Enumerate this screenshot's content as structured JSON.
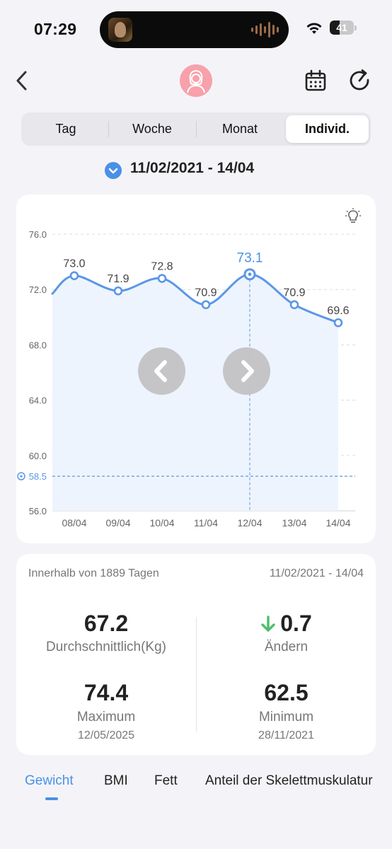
{
  "status": {
    "time": "07:29",
    "battery": "41",
    "battery_level": 0.41
  },
  "header": {
    "avatar_icon": "avatar-icon",
    "calendar_icon": "calendar-icon",
    "refresh_icon": "refresh-icon",
    "back_icon": "back-chevron-icon"
  },
  "segments": [
    {
      "label": "Tag",
      "active": false
    },
    {
      "label": "Woche",
      "active": false
    },
    {
      "label": "Monat",
      "active": false
    },
    {
      "label": "Individ.",
      "active": true
    }
  ],
  "date_range": "11/02/2021 - 14/04",
  "chart_data": {
    "type": "line",
    "categories": [
      "08/04",
      "09/04",
      "10/04",
      "11/04",
      "12/04",
      "13/04",
      "14/04"
    ],
    "values": [
      73.0,
      71.9,
      72.8,
      70.9,
      73.1,
      70.9,
      69.6
    ],
    "value_labels": [
      "73.0",
      "71.9",
      "72.8",
      "70.9",
      "73.1",
      "70.9",
      "69.6"
    ],
    "selected_index": 4,
    "y_ticks": [
      "76.0",
      "72.0",
      "68.0",
      "64.0",
      "60.0",
      "56.0"
    ],
    "ylim": [
      56,
      76
    ],
    "target_label": "58.5",
    "target_value": 58.5,
    "line_color": "#5b97e6",
    "grid": true
  },
  "stats": {
    "period": "Innerhalb von 1889 Tagen",
    "range": "11/02/2021 - 14/04",
    "average": {
      "value": "67.2",
      "label": "Durchschnittlich(Kg)"
    },
    "change": {
      "value": "0.7",
      "label": "Ändern",
      "direction": "down",
      "color": "#4cbf6b"
    },
    "maximum": {
      "value": "74.4",
      "label": "Maximum",
      "date": "12/05/2025"
    },
    "minimum": {
      "value": "62.5",
      "label": "Minimum",
      "date": "28/11/2021"
    }
  },
  "bottom_tabs": [
    {
      "label": "Gewicht",
      "active": true
    },
    {
      "label": "BMI",
      "active": false
    },
    {
      "label": "Fett",
      "active": false
    },
    {
      "label": "Anteil der Skelettmuskulatur",
      "active": false
    }
  ],
  "accent_color": "#4a90e8"
}
